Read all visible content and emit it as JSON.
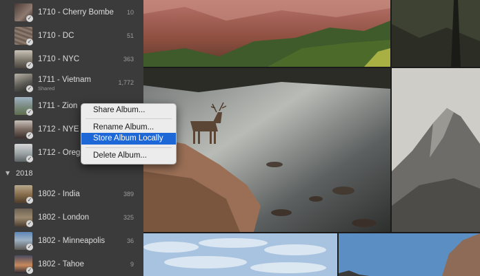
{
  "sidebar": {
    "albums": [
      {
        "name": "1710 - Cherry Bombe",
        "count": "10"
      },
      {
        "name": "1710 - DC",
        "count": "51"
      },
      {
        "name": "1710 - NYC",
        "count": "363"
      },
      {
        "name": "1711 - Vietnam",
        "count": "1,772",
        "sub": "Shared"
      },
      {
        "name": "1711 - Zion",
        "count": ""
      },
      {
        "name": "1712 - NYE W",
        "count": ""
      },
      {
        "name": "1712 - Orego",
        "count": ""
      }
    ],
    "year": "2018",
    "albums_2018": [
      {
        "name": "1802 - India",
        "count": "389"
      },
      {
        "name": "1802 - London",
        "count": "325"
      },
      {
        "name": "1802 - Minneapolis",
        "count": "36"
      },
      {
        "name": "1802 - Tahoe",
        "count": "9"
      }
    ]
  },
  "context_menu": {
    "items": [
      "Share Album...",
      "Rename Album...",
      "Store Album Locally",
      "Delete Album..."
    ],
    "selected": "Store Album Locally"
  },
  "icons": {
    "album_badge": "checkmark-icon",
    "year_toggle": "disclosure-triangle-icon"
  },
  "colors": {
    "sidebar_bg": "#3b3b3b",
    "menu_highlight": "#1d67d6"
  }
}
